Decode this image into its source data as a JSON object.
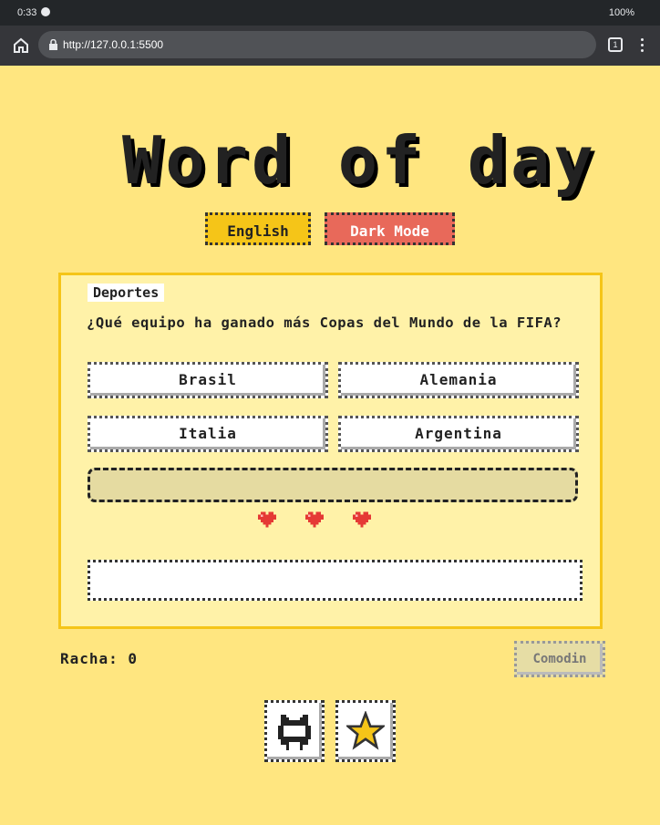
{
  "status_bar": {
    "time": "0:33",
    "right": "100%"
  },
  "browser": {
    "url": "http://127.0.0.1:5500",
    "tab_count": "1"
  },
  "app": {
    "title": "Word of day"
  },
  "toolbar": {
    "language_label": "English",
    "theme_label": "Dark Mode"
  },
  "quiz": {
    "category": "Deportes",
    "question": "¿Qué equipo ha ganado más Copas del Mundo de la FIFA?",
    "options": [
      "Brasil",
      "Alemania",
      "Italia",
      "Argentina"
    ],
    "lives": 3
  },
  "footer": {
    "streak_label": "Racha: 0",
    "wildcard_label": "Comodin"
  },
  "icons": {
    "github": "github-icon",
    "star": "star-icon",
    "heart": "heart-icon"
  },
  "colors": {
    "background": "#ffe680",
    "card": "#fff2a8",
    "accent": "#f5c518",
    "dark_mode_button": "#e8695a"
  }
}
